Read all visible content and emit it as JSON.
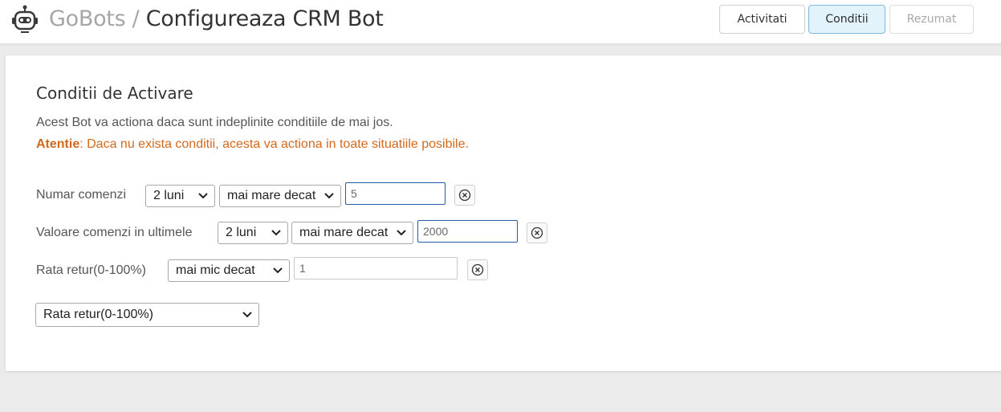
{
  "header": {
    "brand": "GoBots",
    "separator": " / ",
    "page_title": "Configureaza CRM Bot",
    "logo_icon": "robot-icon",
    "tabs": [
      {
        "label": "Activitati",
        "state": "normal"
      },
      {
        "label": "Conditii",
        "state": "active"
      },
      {
        "label": "Rezumat",
        "state": "disabled"
      }
    ]
  },
  "section": {
    "title": "Conditii de Activare",
    "description": "Acest Bot va actiona daca sunt indeplinite conditiile de mai jos.",
    "warning_label": "Atentie",
    "warning_text": ": Daca nu exista conditii, acesta va actiona in toate situatiile posibile."
  },
  "conditions": [
    {
      "label": "Numar comenzi",
      "period": "2 luni",
      "operator": "mai mare decat",
      "value": "5"
    },
    {
      "label": "Valoare comenzi in ultimele",
      "period": "2 luni",
      "operator": "mai mare decat",
      "value": "2000"
    },
    {
      "label": "Rata retur(0-100%)",
      "operator": "mai mic decat",
      "value": "1"
    }
  ],
  "add_condition_select": "Rata retur(0-100%)",
  "colors": {
    "warning": "#d2691e",
    "active_tab_bg": "#e2f3fb",
    "focus_border": "#1f5fa8",
    "page_bg": "#ebebeb"
  }
}
